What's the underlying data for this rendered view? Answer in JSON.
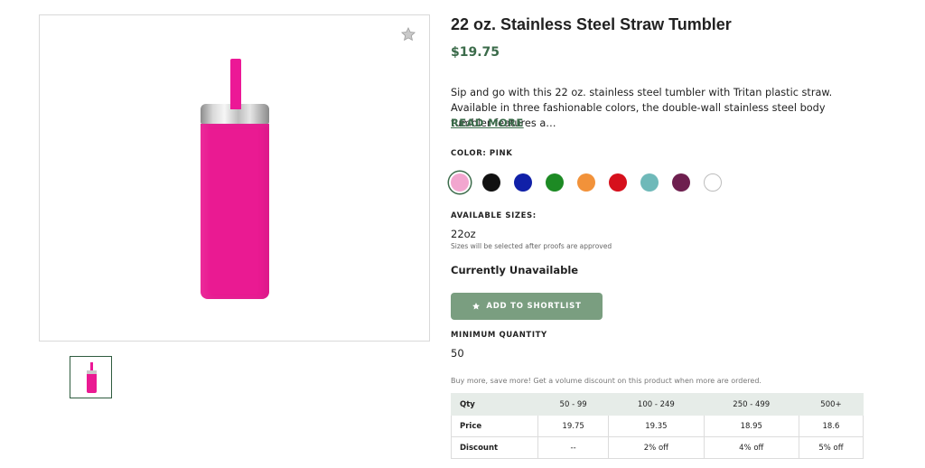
{
  "product": {
    "title": "22 oz. Stainless Steel Straw Tumbler",
    "price": "$19.75",
    "description": "Sip and go with this 22 oz. stainless steel tumbler with Tritan plastic straw. Available in three fashionable colors, the double-wall stainless steel body tumbler features a…",
    "read_more": "READ MORE"
  },
  "gallery": {
    "favorite_icon": "star-icon",
    "image_color": "#ea1a92"
  },
  "color": {
    "label": "COLOR: PINK",
    "swatches": [
      {
        "name": "pink",
        "hex": "#f2a6cf",
        "selected": true
      },
      {
        "name": "black",
        "hex": "#111111"
      },
      {
        "name": "blue",
        "hex": "#1020a8"
      },
      {
        "name": "green",
        "hex": "#1d8a24"
      },
      {
        "name": "orange",
        "hex": "#f2923a"
      },
      {
        "name": "red",
        "hex": "#d6101c"
      },
      {
        "name": "teal",
        "hex": "#6fb9b9"
      },
      {
        "name": "maroon",
        "hex": "#6e1f4f"
      },
      {
        "name": "white",
        "hex": "#ffffff"
      }
    ]
  },
  "sizes": {
    "label": "AVAILABLE SIZES:",
    "value": "22oz",
    "note": "Sizes will be selected after proofs are approved"
  },
  "availability": "Currently Unavailable",
  "shortlist_button": {
    "label": "ADD TO SHORTLIST",
    "icon": "star-icon",
    "color": "#7a9e80"
  },
  "minimum_quantity": {
    "label": "MINIMUM QUANTITY",
    "value": "50"
  },
  "volume_note": "Buy more, save more! Get a volume discount on this product when more are ordered.",
  "pricing_table": {
    "headers": [
      "Qty",
      "50 - 99",
      "100 - 249",
      "250 - 499",
      "500+"
    ],
    "rows": [
      [
        "Price",
        "19.75",
        "19.35",
        "18.95",
        "18.6"
      ],
      [
        "Discount",
        "--",
        "2% off",
        "4% off",
        "5% off"
      ]
    ]
  }
}
